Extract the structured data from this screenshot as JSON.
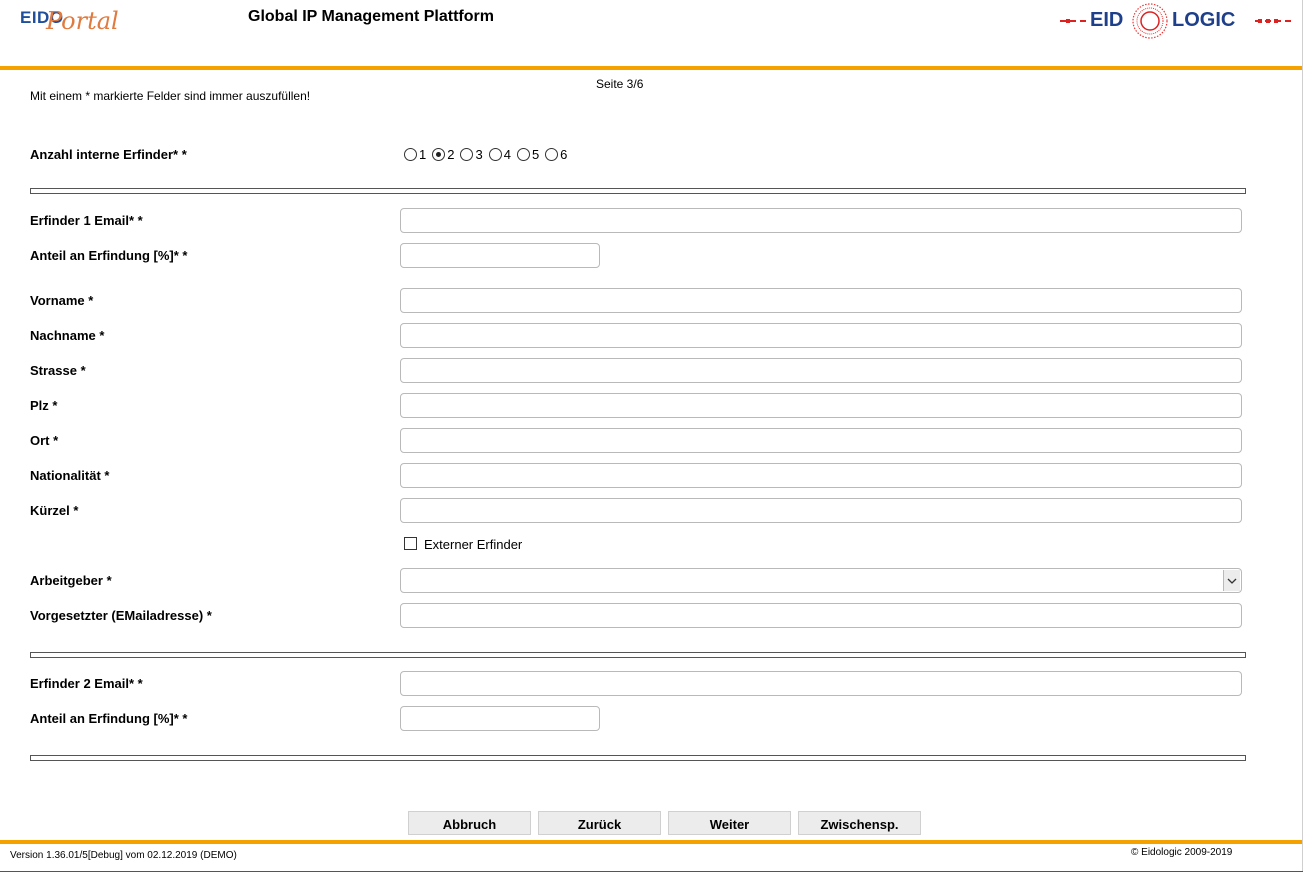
{
  "header": {
    "logo_eido": "EIDO",
    "logo_portal": "Portal",
    "app_title": "Global IP Management Plattform",
    "brand_left": "EID",
    "brand_right": "LOGIC",
    "accent_color": "#f5a100"
  },
  "page": {
    "indicator": "Seite 3/6",
    "required_note": "Mit einem * markierte Felder sind immer auszufüllen!"
  },
  "inventor_count": {
    "label": "Anzahl interne Erfinder* *",
    "options": [
      "1",
      "2",
      "3",
      "4",
      "5",
      "6"
    ],
    "selected": "2"
  },
  "inventor1": {
    "email_label": "Erfinder 1 Email* *",
    "share_label": "Anteil an Erfindung [%]* *",
    "firstname_label": "Vorname *",
    "lastname_label": "Nachname *",
    "street_label": "Strasse *",
    "zip_label": "Plz *",
    "city_label": "Ort *",
    "nationality_label": "Nationalität *",
    "short_label": "Kürzel *",
    "external_label": "Externer Erfinder",
    "employer_label": "Arbeitgeber *",
    "supervisor_label": "Vorgesetzter (EMailadresse) *",
    "email_value": "",
    "share_value": "",
    "firstname_value": "",
    "lastname_value": "",
    "street_value": "",
    "zip_value": "",
    "city_value": "",
    "nationality_value": "",
    "short_value": "",
    "employer_value": "",
    "supervisor_value": ""
  },
  "inventor2": {
    "email_label": "Erfinder 2 Email* *",
    "share_label": "Anteil an Erfindung [%]* *",
    "email_value": "",
    "share_value": ""
  },
  "buttons": {
    "cancel": "Abbruch",
    "back": "Zurück",
    "next": "Weiter",
    "save": "Zwischensp."
  },
  "footer": {
    "version": "Version 1.36.01/5[Debug] vom 02.12.2019 (DEMO)",
    "copyright": "© Eidologic 2009-2019"
  },
  "icons": {
    "select_arrow": "chevron-down-icon"
  }
}
